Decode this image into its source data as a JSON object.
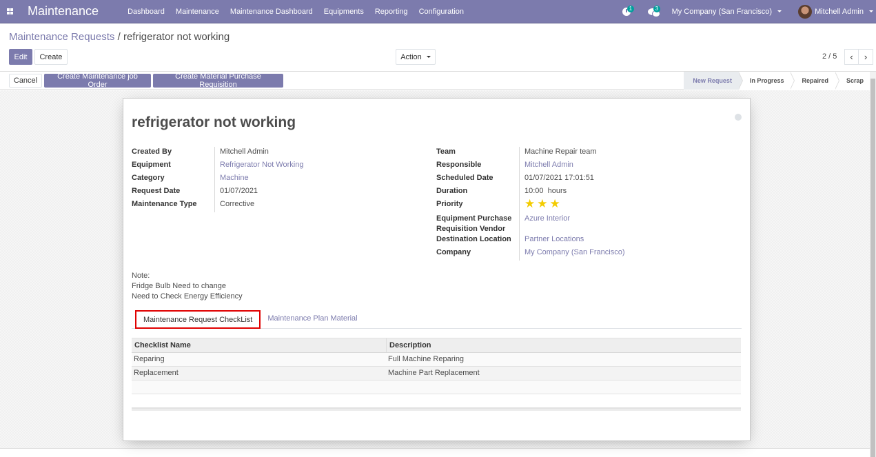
{
  "navbar": {
    "app_name": "Maintenance",
    "menu": [
      "Dashboard",
      "Maintenance",
      "Maintenance Dashboard",
      "Equipments",
      "Reporting",
      "Configuration"
    ],
    "activity_count": "1",
    "messages_count": "3",
    "company": "My Company (San Francisco)",
    "user": "Mitchell Admin"
  },
  "control_panel": {
    "breadcrumb_parent": "Maintenance Requests",
    "breadcrumb_separator": "/",
    "breadcrumb_current": "refrigerator not working",
    "edit_label": "Edit",
    "create_label": "Create",
    "action_label": "Action",
    "pager": "2 / 5",
    "prev_icon": "‹",
    "next_icon": "›"
  },
  "statusbar": {
    "buttons": [
      "Cancel",
      "Create Maintenance job Order",
      "Create Material Purchase Requisition"
    ],
    "stages": [
      {
        "label": "New Request",
        "active": true
      },
      {
        "label": "In Progress",
        "active": false
      },
      {
        "label": "Repaired",
        "active": false
      },
      {
        "label": "Scrap",
        "active": false
      }
    ]
  },
  "form": {
    "title": "refrigerator not working",
    "left_fields": [
      {
        "label": "Created By",
        "value": "Mitchell Admin",
        "link": false
      },
      {
        "label": "Equipment",
        "value": "Refrigerator Not Working",
        "link": true
      },
      {
        "label": "Category",
        "value": "Machine",
        "link": true
      },
      {
        "label": "Request Date",
        "value": "01/07/2021",
        "link": false
      },
      {
        "label": "Maintenance Type",
        "value": "Corrective",
        "link": false
      }
    ],
    "right_fields": [
      {
        "label": "Team",
        "value": "Machine Repair team",
        "link": false
      },
      {
        "label": "Responsible",
        "value": "Mitchell Admin",
        "link": true
      },
      {
        "label": "Scheduled Date",
        "value": "01/07/2021 17:01:51",
        "link": false
      },
      {
        "label": "Duration",
        "value": "10:00  hours",
        "link": false
      },
      {
        "label": "Priority",
        "value": "",
        "link": false
      },
      {
        "label": "Equipment Purchase Requisition Vendor",
        "value": "Azure Interior",
        "link": true
      },
      {
        "label": "Destination Location",
        "value": "Partner Locations",
        "link": true
      },
      {
        "label": "Company",
        "value": "My Company (San Francisco)",
        "link": true
      }
    ],
    "priority": {
      "stars_filled": 3,
      "stars_total": 3,
      "star_color": "#f3cc00"
    },
    "note_lines": [
      "Note:",
      "Fridge Bulb Need to change",
      "Need to Check Energy Efficiency"
    ],
    "tabs": [
      {
        "label": "Maintenance Request CheckList",
        "active": true
      },
      {
        "label": "Maintenance Plan Material",
        "active": false
      }
    ],
    "checklist": {
      "columns": [
        "Checklist Name",
        "Description"
      ],
      "rows": [
        [
          "Reparing",
          "Full Machine Reparing"
        ],
        [
          "Replacement",
          "Machine Part Replacement"
        ]
      ]
    }
  },
  "colors": {
    "brand": "#7c7bad",
    "highlight_box": "#e00000",
    "badge": "#00a09d"
  }
}
